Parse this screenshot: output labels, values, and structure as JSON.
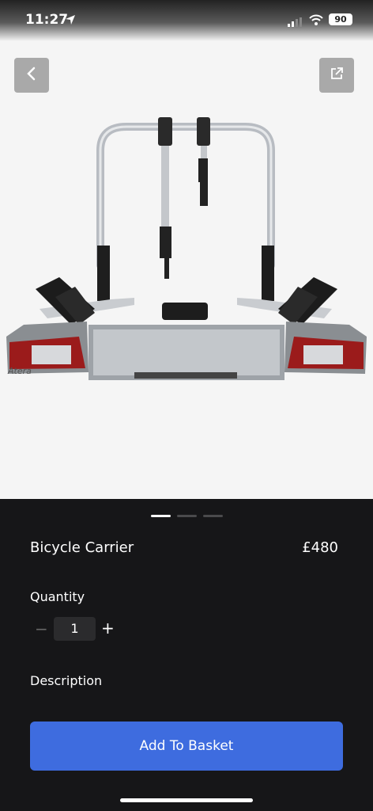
{
  "status": {
    "time": "11:27",
    "battery": "90"
  },
  "product": {
    "name": "Bicycle Carrier",
    "price": "£480",
    "image_brand": "Atera"
  },
  "carousel": {
    "count": 3,
    "active": 0
  },
  "quantity": {
    "label": "Quantity",
    "value": "1",
    "minus": "−",
    "plus": "+"
  },
  "description": {
    "label": "Description"
  },
  "actions": {
    "add_to_basket": "Add To Basket"
  },
  "icons": [
    "location-arrow-icon",
    "signal-icon",
    "wifi-icon",
    "battery-icon",
    "back-chevron-icon",
    "share-icon"
  ],
  "colors": {
    "accent": "#3e6cdf",
    "background": "#161618",
    "image_bg": "#f5f5f5"
  }
}
